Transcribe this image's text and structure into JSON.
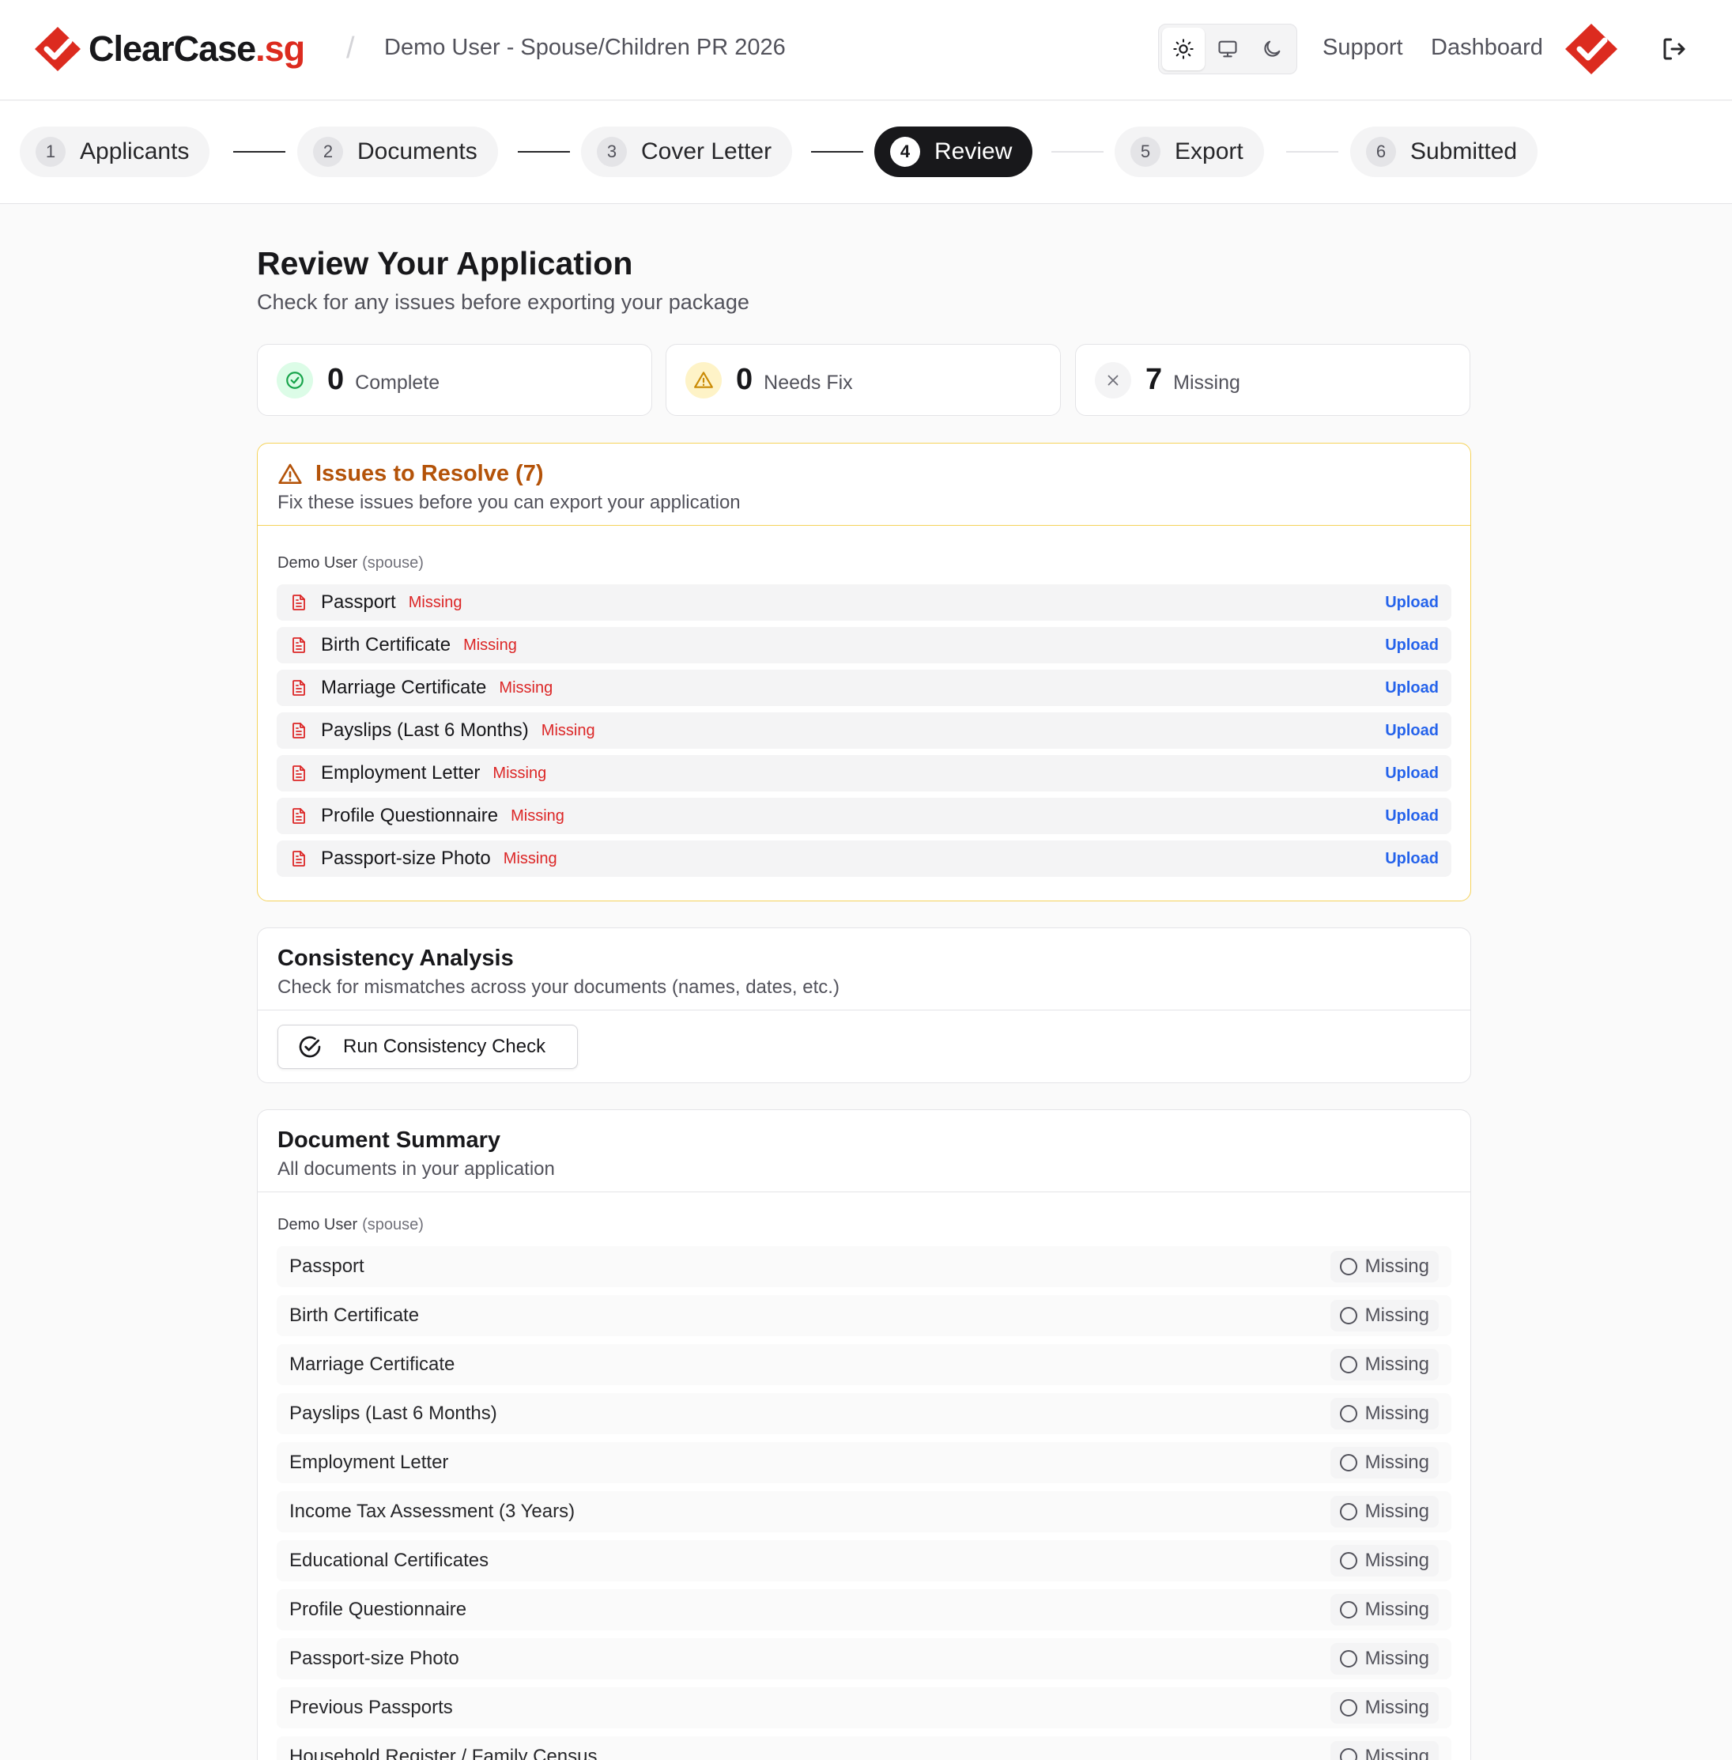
{
  "brand": {
    "name": "ClearCase",
    "tld": ".sg",
    "accent": "#dc2b1f"
  },
  "header": {
    "breadcrumb_separator": "/",
    "breadcrumb": "Demo User - Spouse/Children PR 2026",
    "theme_options": [
      "sun-icon",
      "monitor-icon",
      "moon-icon"
    ],
    "links": {
      "support": "Support",
      "dashboard": "Dashboard"
    }
  },
  "stepper": {
    "steps": [
      {
        "num": "1",
        "label": "Applicants"
      },
      {
        "num": "2",
        "label": "Documents"
      },
      {
        "num": "3",
        "label": "Cover Letter"
      },
      {
        "num": "4",
        "label": "Review"
      },
      {
        "num": "5",
        "label": "Export"
      },
      {
        "num": "6",
        "label": "Submitted"
      }
    ],
    "active_step": "4"
  },
  "page": {
    "title": "Review Your Application",
    "subtitle": "Check for any issues before exporting your package"
  },
  "stats": {
    "complete": {
      "value": "0",
      "label": "Complete",
      "color": "#16a34a"
    },
    "needs_fix": {
      "value": "0",
      "label": "Needs Fix",
      "color": "#ca8a04"
    },
    "missing": {
      "value": "7",
      "label": "Missing",
      "color": "#71717a"
    }
  },
  "issues": {
    "title": "Issues to Resolve (7)",
    "description": "Fix these issues before you can export your application",
    "applicant": {
      "name": "Demo User",
      "role": "(spouse)"
    },
    "items": [
      {
        "name": "Passport",
        "status": "Missing",
        "action": "Upload"
      },
      {
        "name": "Birth Certificate",
        "status": "Missing",
        "action": "Upload"
      },
      {
        "name": "Marriage Certificate",
        "status": "Missing",
        "action": "Upload"
      },
      {
        "name": "Payslips (Last 6 Months)",
        "status": "Missing",
        "action": "Upload"
      },
      {
        "name": "Employment Letter",
        "status": "Missing",
        "action": "Upload"
      },
      {
        "name": "Profile Questionnaire",
        "status": "Missing",
        "action": "Upload"
      },
      {
        "name": "Passport-size Photo",
        "status": "Missing",
        "action": "Upload"
      }
    ]
  },
  "consistency": {
    "title": "Consistency Analysis",
    "description": "Check for mismatches across your documents (names, dates, etc.)",
    "button_label": "Run Consistency Check"
  },
  "summary": {
    "title": "Document Summary",
    "description": "All documents in your application",
    "applicant": {
      "name": "Demo User",
      "role": "(spouse)"
    },
    "items": [
      {
        "name": "Passport",
        "status": "Missing"
      },
      {
        "name": "Birth Certificate",
        "status": "Missing"
      },
      {
        "name": "Marriage Certificate",
        "status": "Missing"
      },
      {
        "name": "Payslips (Last 6 Months)",
        "status": "Missing"
      },
      {
        "name": "Employment Letter",
        "status": "Missing"
      },
      {
        "name": "Income Tax Assessment (3 Years)",
        "status": "Missing"
      },
      {
        "name": "Educational Certificates",
        "status": "Missing"
      },
      {
        "name": "Profile Questionnaire",
        "status": "Missing"
      },
      {
        "name": "Passport-size Photo",
        "status": "Missing"
      },
      {
        "name": "Previous Passports",
        "status": "Missing"
      },
      {
        "name": "Household Register / Family Census",
        "status": "Missing"
      }
    ]
  }
}
